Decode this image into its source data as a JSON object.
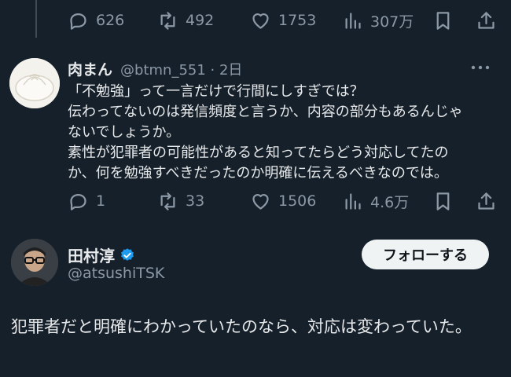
{
  "top_actions": {
    "replies": "626",
    "retweets": "492",
    "likes": "1753",
    "views": "307万"
  },
  "reply": {
    "name": "肉まん",
    "handle_time": "@btmn_551 · 2日",
    "lines": [
      "「不勉強」って一言だけで行間にしすぎでは？",
      "伝わってないのは発信頻度と言うか、内容の部分もあるんじゃ",
      "ないでしょうか。",
      "素性が犯罪者の可能性があると知ってたらどう対応してたの",
      "か、何を勉強すべきだったのか明確に伝えるべきなのでは。"
    ],
    "actions": {
      "replies": "1",
      "retweets": "33",
      "likes": "1506",
      "views": "4.6万"
    }
  },
  "author": {
    "name": "田村淳",
    "handle": "@atsushiTSK",
    "follow_label": "フォローする"
  },
  "post": {
    "text": "犯罪者だと明確にわかっていたのなら、対応は変わっていた。"
  },
  "colors": {
    "background": "#15202b",
    "text": "#e7e9ea",
    "muted": "#8b98a5",
    "verified": "#1d9bf0"
  }
}
